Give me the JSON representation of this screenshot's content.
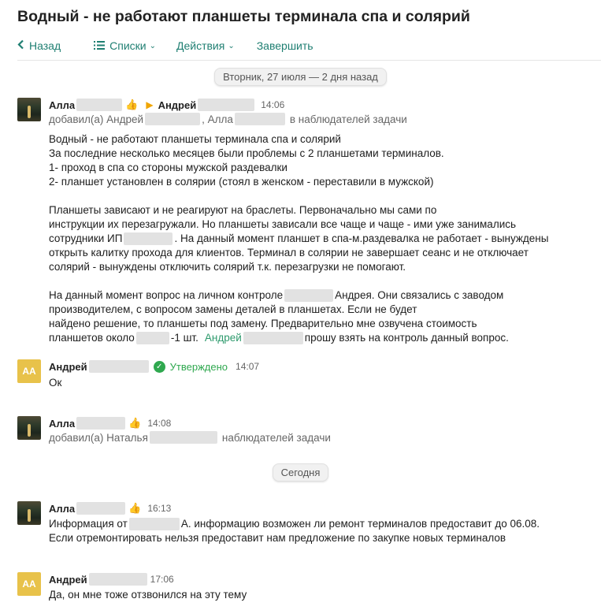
{
  "title": "Водный - не работают планшеты терминала спа и солярий",
  "toolbar": {
    "back": "Назад",
    "lists": "Списки",
    "actions": "Действия",
    "finish": "Завершить"
  },
  "date_separators": {
    "first": "Вторник, 27 июля — 2 дня назад",
    "today": "Сегодня"
  },
  "messages": [
    {
      "author": "Алла",
      "recipient": "Андрей",
      "time": "14:06",
      "system": {
        "added": "добавил(а) Андрей",
        "name2": ", Алла",
        "suffix": "в наблюдателей задачи"
      },
      "lines": {
        "l1": "Водный - не работают планшеты терминала спа и солярий",
        "l2": "За последние несколько месяцев были проблемы с 2 планшетами терминалов.",
        "l3": "1- проход в спа со стороны мужской раздевалки",
        "l4": "2- планшет установлен в солярии (стоял в женском - переставили в мужской)",
        "l5": "Планшеты зависают и не реагируют на браслеты. Первоначально мы сами по",
        "l6": "инструкции их перезагружали. Но планшеты зависали все чаще и чаще - ими уже занимались",
        "l7a": "сотрудники ИП",
        "l7b": ". На данный момент планшет в спа-м.раздевалка не работает - вынуждены",
        "l8": "открыть калитку прохода для клиентов. Терминал в солярии не завершает сеанс и не отключает",
        "l9": "солярий - вынуждены отключить солярий т.к. перезагрузки не помогают.",
        "l10a": "На данный момент вопрос на личном контроле",
        "l10b": "Андрея. Они связались с заводом",
        "l11": "производителем, с вопросом замены деталей в планшетах. Если не будет",
        "l12": "найдено решение, то планшеты под замену. Предварительно мне озвучена стоимость",
        "l13a": "планшетов около",
        "l13b": "-1 шт.",
        "l13mention": "Андрей",
        "l13c": "прошу взять на контроль данный вопрос."
      }
    },
    {
      "author": "Андрей",
      "avatar": "АА",
      "status": "Утверждено",
      "time": "14:07",
      "text": "Ок"
    },
    {
      "author": "Алла",
      "time": "14:08",
      "system": {
        "added": "добавил(а) Наталья",
        "suffix": "наблюдателей задачи"
      }
    },
    {
      "author": "Алла",
      "time": "16:13",
      "lines": {
        "l1a": "Информация от",
        "l1b": "А. информацию возможен ли ремонт терминалов предоставит до 06.08.",
        "l2": "Если отремонтировать нельзя предоставит нам предложение по закупке новых терминалов"
      }
    },
    {
      "author": "Андрей",
      "avatar": "АА",
      "time": "17:06",
      "text": "Да, он мне тоже отзвонился на эту тему"
    }
  ],
  "icons": {
    "back": "chevron-left-icon",
    "lists": "list-icon",
    "like": "thumbs-up-icon",
    "arrow": "arrow-right-icon",
    "approved": "check-circle-icon"
  },
  "colors": {
    "accent": "#1f7f72",
    "approved": "#2fa84f",
    "mention": "#2d9a6c",
    "avatar_initials_bg": "#e8c24a"
  }
}
